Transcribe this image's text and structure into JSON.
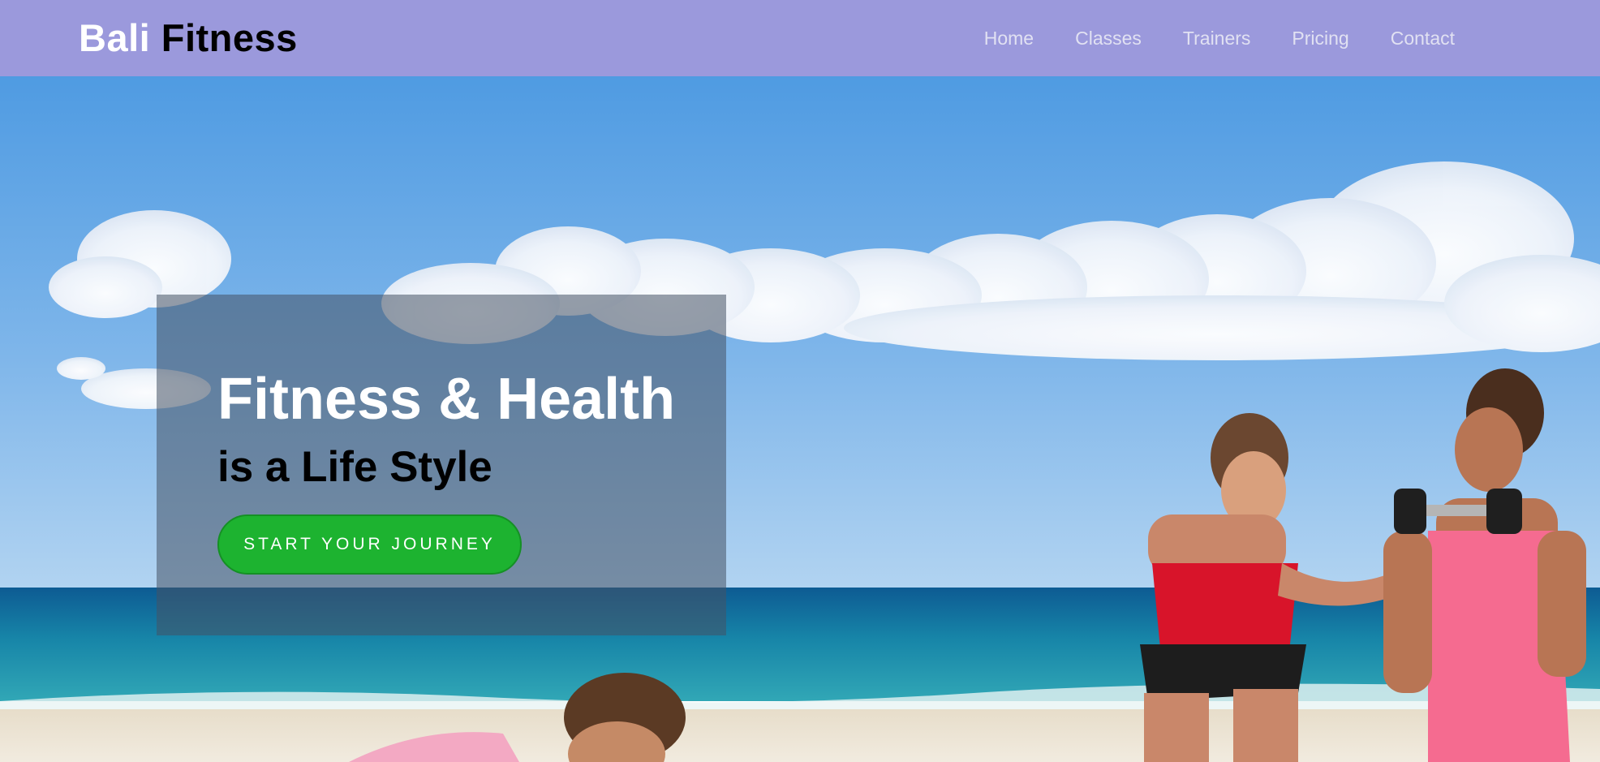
{
  "brand": {
    "word1": "Bali",
    "word2": "Fitness"
  },
  "nav": {
    "items": [
      {
        "label": "Home"
      },
      {
        "label": "Classes"
      },
      {
        "label": "Trainers"
      },
      {
        "label": "Pricing"
      },
      {
        "label": "Contact"
      }
    ]
  },
  "hero": {
    "heading": "Fitness & Health",
    "subheading": "is a Life Style",
    "cta_label": "START YOUR JOURNEY",
    "image": "beach-fitness-photo"
  },
  "colors": {
    "header_bg": "#9b99dc",
    "nav_text": "#e1e1f2",
    "cta_bg": "#1db330",
    "overlay": "rgba(70,82,100,0.55)"
  }
}
